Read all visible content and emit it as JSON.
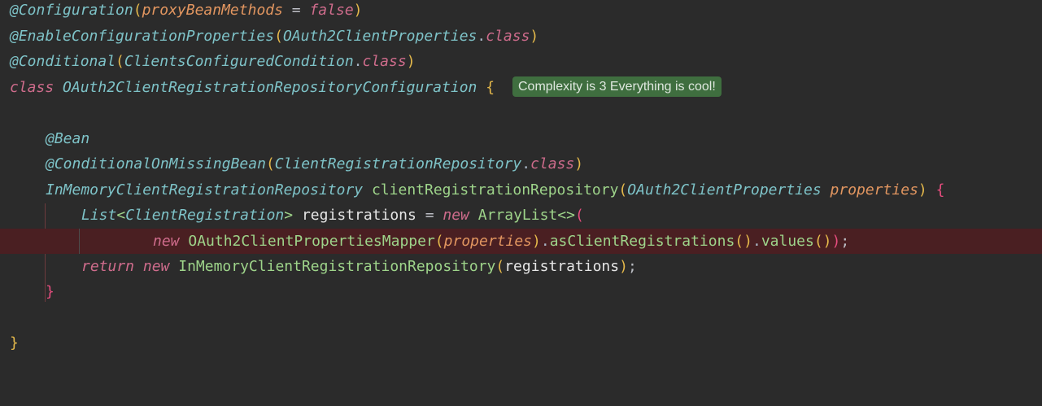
{
  "badge": {
    "text": "Complexity is 3 Everything is cool!",
    "color": "#3f6e3f"
  },
  "code": {
    "l1": {
      "anno": "@Configuration",
      "open": "(",
      "param": "proxyBeanMethods",
      "eq": " = ",
      "kw": "false",
      "close": ")"
    },
    "l2": {
      "anno": "@EnableConfigurationProperties",
      "open": "(",
      "type": "OAuth2ClientProperties",
      "dot": ".",
      "kw": "class",
      "close": ")"
    },
    "l3": {
      "anno": "@Conditional",
      "open": "(",
      "type": "ClientsConfiguredCondition",
      "dot": ".",
      "kw": "class",
      "close": ")"
    },
    "l4": {
      "kw": "class",
      "type": "OAuth2ClientRegistrationRepositoryConfiguration",
      "brace": "{"
    },
    "l6": {
      "anno": "@Bean"
    },
    "l7": {
      "anno": "@ConditionalOnMissingBean",
      "open": "(",
      "type": "ClientRegistrationRepository",
      "dot": ".",
      "kw": "class",
      "close": ")"
    },
    "l8": {
      "type": "InMemoryClientRegistrationRepository",
      "method": "clientRegistrationRepository",
      "open": "(",
      "ptype": "OAuth2ClientProperties",
      "param": "properties",
      "close": ")",
      "brace": "{"
    },
    "l9": {
      "type": "List",
      "lt": "<",
      "gtype": "ClientRegistration",
      "gt": ">",
      "var": "registrations",
      "eq": " = ",
      "kw": "new",
      "cls": "ArrayList",
      "diamond": "<>",
      "open": "("
    },
    "l10": {
      "kw": "new",
      "cls": "OAuth2ClientPropertiesMapper",
      "open": "(",
      "param": "properties",
      "close": ")",
      "dot1": ".",
      "m1": "asClientRegistrations",
      "p1": "()",
      "dot2": ".",
      "m2": "values",
      "p2": "()",
      "close2": ")",
      "semi": ";"
    },
    "l11": {
      "kw": "return",
      "kw2": "new",
      "cls": "InMemoryClientRegistrationRepository",
      "open": "(",
      "var": "registrations",
      "close": ")",
      "semi": ";"
    },
    "l12": {
      "brace": "}"
    },
    "l14": {
      "brace": "}"
    }
  }
}
